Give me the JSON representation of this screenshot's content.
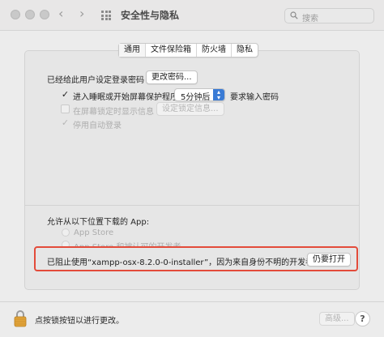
{
  "window": {
    "title": "安全性与隐私",
    "search_placeholder": "搜索"
  },
  "tabs": [
    {
      "label": "通用",
      "active": true
    },
    {
      "label": "文件保险箱",
      "active": false
    },
    {
      "label": "防火墙",
      "active": false
    },
    {
      "label": "隐私",
      "active": false
    }
  ],
  "general": {
    "password_label": "已经给此用户设定登录密码",
    "change_password_button": "更改密码...",
    "require_password_prefix": "进入睡眠或开始屏幕保护程序",
    "require_password_delay": "5分钟后",
    "require_password_suffix": "要求输入密码",
    "show_message_label": "在屏幕锁定时显示信息",
    "set_lock_message_button": "设定锁定信息...",
    "disable_auto_login_label": "停用自动登录"
  },
  "downloads": {
    "heading": "允许从以下位置下载的 App:",
    "option_app_store": "App Store",
    "option_identified": "App Store 和被认可的开发者",
    "blocked_message": "已阻止使用“xampp-osx-8.2.0-0-installer”，因为来自身份不明的开发者。",
    "open_anyway_button": "仍要打开"
  },
  "footer": {
    "lock_text": "点按锁按钮以进行更改。",
    "advanced_button": "高级...",
    "help_button": "?"
  },
  "colors": {
    "highlight_border": "#e34b3a",
    "select_accent": "#3a7bd5"
  }
}
